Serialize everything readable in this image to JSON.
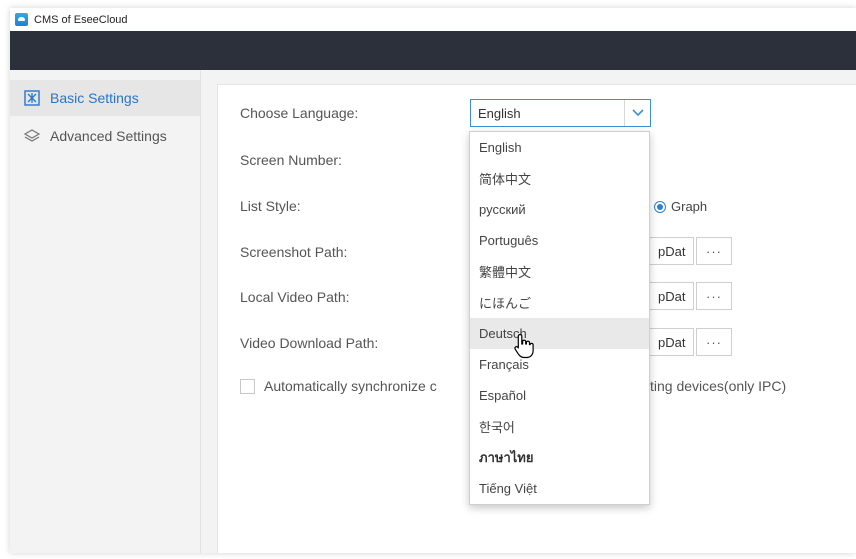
{
  "window": {
    "title": "CMS of EseeCloud"
  },
  "sidebar": {
    "items": [
      {
        "label": "Basic Settings",
        "icon": "basic-settings-icon",
        "active": true
      },
      {
        "label": "Advanced Settings",
        "icon": "layers-icon",
        "active": false
      }
    ]
  },
  "settings": {
    "choose_language_label": "Choose Language:",
    "language_selected": "English",
    "screen_number_label": "Screen Number:",
    "list_style_label": "List Style:",
    "list_style_graph_label": "Graph",
    "screenshot_path_label": "Screenshot Path:",
    "screenshot_path_value": "pDat",
    "local_video_path_label": "Local Video Path:",
    "local_video_path_value": "pDat",
    "video_download_path_label": "Video Download Path:",
    "video_download_path_value": "pDat",
    "browse_label": "···",
    "sync_label_visible": "Automatically synchronize c",
    "sync_label_tail": "ting devices(only IPC)"
  },
  "language_dropdown": {
    "options": [
      "English",
      "简体中文",
      "русский",
      "Português",
      "繁體中文",
      "にほんご",
      "Deutsch",
      "Français",
      "Español",
      "한국어",
      "ภาษาไทย",
      "Tiếng Việt"
    ],
    "hovered": "Deutsch"
  },
  "colors": {
    "accent": "#2f7fd0",
    "header_dark": "#2b303b",
    "sidebar_bg": "#f3f3f3"
  }
}
